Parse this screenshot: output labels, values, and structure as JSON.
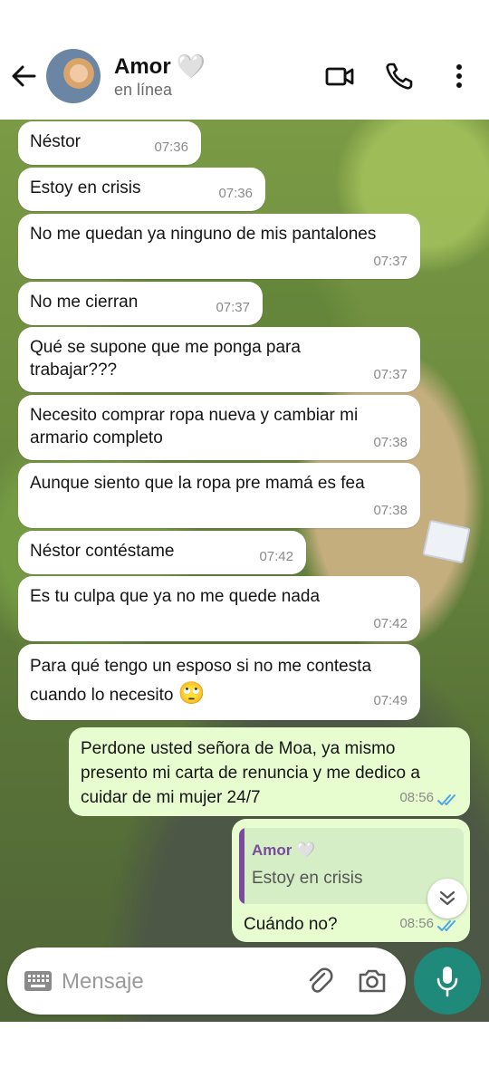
{
  "header": {
    "contact_name": "Amor",
    "heart": "🤍",
    "status": "en línea",
    "icons": [
      "back-arrow-icon",
      "video-call-icon",
      "phone-call-icon",
      "more-options-icon"
    ]
  },
  "messages": [
    {
      "dir": "in",
      "text": "Néstor",
      "time": "07:36"
    },
    {
      "dir": "in",
      "text": "Estoy en crisis",
      "time": "07:36"
    },
    {
      "dir": "in",
      "text": "No me quedan ya ninguno de mis pantalones",
      "time": "07:37"
    },
    {
      "dir": "in",
      "text": "No me cierran",
      "time": "07:37"
    },
    {
      "dir": "in",
      "text": "Qué se supone que me ponga para trabajar???",
      "time": "07:37"
    },
    {
      "dir": "in",
      "text": "Necesito comprar ropa nueva y cambiar mi armario completo",
      "time": "07:38"
    },
    {
      "dir": "in",
      "text": "Aunque siento que la ropa pre mamá es fea",
      "time": "07:38"
    },
    {
      "dir": "in",
      "text": "Néstor contéstame",
      "time": "07:42"
    },
    {
      "dir": "in",
      "text": "Es tu culpa que ya no me quede nada",
      "time": "07:42"
    },
    {
      "dir": "in",
      "text": "Para qué tengo un esposo si no me contesta cuando lo necesito",
      "emoji": "🙄",
      "time": "07:49"
    },
    {
      "dir": "out",
      "text": "Perdone usted señora de Moa, ya mismo presento mi carta de renuncia y me dedico a cuidar de mi mujer 24/7",
      "time": "08:56",
      "status": "read"
    },
    {
      "dir": "out",
      "reply_to": {
        "name": "Amor",
        "heart": "🤍",
        "text": "Estoy en crisis"
      },
      "text": "Cuándo no?",
      "time": "08:56",
      "status": "read"
    }
  ],
  "input": {
    "placeholder": "Mensaje",
    "icons": [
      "keyboard-icon",
      "attach-icon",
      "camera-icon",
      "microphone-icon"
    ]
  },
  "colors": {
    "outgoing_bubble": "#e7fdd0",
    "incoming_bubble": "#ffffff",
    "mic_button": "#1f8a7a",
    "read_ticks": "#4aa6e8",
    "quote_accent": "#7a4b9c"
  }
}
